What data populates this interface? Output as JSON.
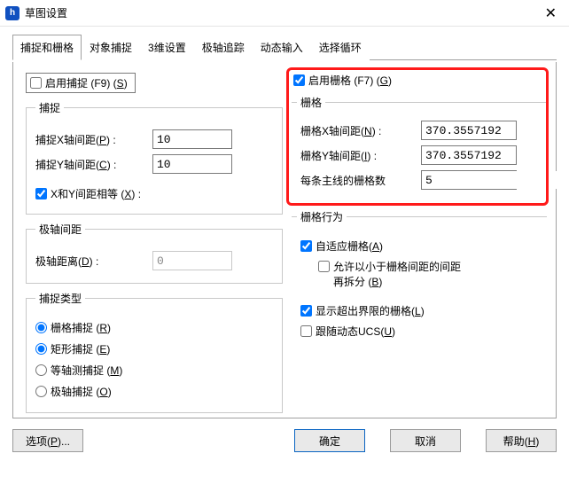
{
  "window": {
    "title": "草图设置",
    "app_icon_letter": "h"
  },
  "tabs": [
    "捕捉和栅格",
    "对象捕捉",
    "3维设置",
    "极轴追踪",
    "动态输入",
    "选择循环"
  ],
  "active_tab": 0,
  "left": {
    "enable_snap_text": "启用捕捉 (F9) (",
    "enable_snap_accel": "S",
    "enable_snap_suffix": ")",
    "enable_snap_checked": false,
    "snap_group": "捕捉",
    "snap_x_label": "捕捉X轴间距(",
    "snap_x_accel": "P",
    "snap_x_suffix": ") :",
    "snap_x_value": "10",
    "snap_y_label": "捕捉Y轴间距(",
    "snap_y_accel": "C",
    "snap_y_suffix": ") :",
    "snap_y_value": "10",
    "xy_equal_text": "X和Y间距相等 (",
    "xy_equal_accel": "X",
    "xy_equal_suffix": ") :",
    "xy_equal_checked": true,
    "polar_group": "极轴间距",
    "polar_dist_label": "极轴距离(",
    "polar_dist_accel": "D",
    "polar_dist_suffix": ") :",
    "polar_dist_value": "0",
    "snap_type_group": "捕捉类型",
    "grid_snap_text": "栅格捕捉 (",
    "grid_snap_accel": "R",
    "grid_snap_suffix": ")",
    "rect_snap_text": "矩形捕捉 (",
    "rect_snap_accel": "E",
    "rect_snap_suffix": ")",
    "iso_snap_text": "等轴测捕捉 (",
    "iso_snap_accel": "M",
    "iso_snap_suffix": ")",
    "polar_snap_text": "极轴捕捉 (",
    "polar_snap_accel": "O",
    "polar_snap_suffix": ")"
  },
  "right": {
    "enable_grid_text": "启用栅格 (F7) (",
    "enable_grid_accel": "G",
    "enable_grid_suffix": ")",
    "enable_grid_checked": true,
    "grid_group": "栅格",
    "grid_x_label": "栅格X轴间距(",
    "grid_x_accel": "N",
    "grid_x_suffix": ") :",
    "grid_x_value": "370.3557192",
    "grid_y_label": "栅格Y轴间距(",
    "grid_y_accel": "I",
    "grid_y_suffix": ") :",
    "grid_y_value": "370.3557192",
    "major_line_label": "每条主线的栅格数",
    "major_line_value": "5",
    "behavior_group": "栅格行为",
    "adaptive_text": "自适应栅格(",
    "adaptive_accel": "A",
    "adaptive_suffix": ")",
    "adaptive_checked": true,
    "subdivide_line1": "允许以小于栅格间距的间距",
    "subdivide_line2": "再拆分 (",
    "subdivide_accel": "B",
    "subdivide_suffix": ")",
    "subdivide_checked": false,
    "beyond_text": "显示超出界限的栅格(",
    "beyond_accel": "L",
    "beyond_suffix": ")",
    "beyond_checked": true,
    "follow_text": "跟随动态UCS(",
    "follow_accel": "U",
    "follow_suffix": ")",
    "follow_checked": false
  },
  "buttons": {
    "options_text": "选项(",
    "options_accel": "P",
    "options_suffix": ")...",
    "ok": "确定",
    "cancel": "取消",
    "help_text": "帮助(",
    "help_accel": "H",
    "help_suffix": ")"
  }
}
